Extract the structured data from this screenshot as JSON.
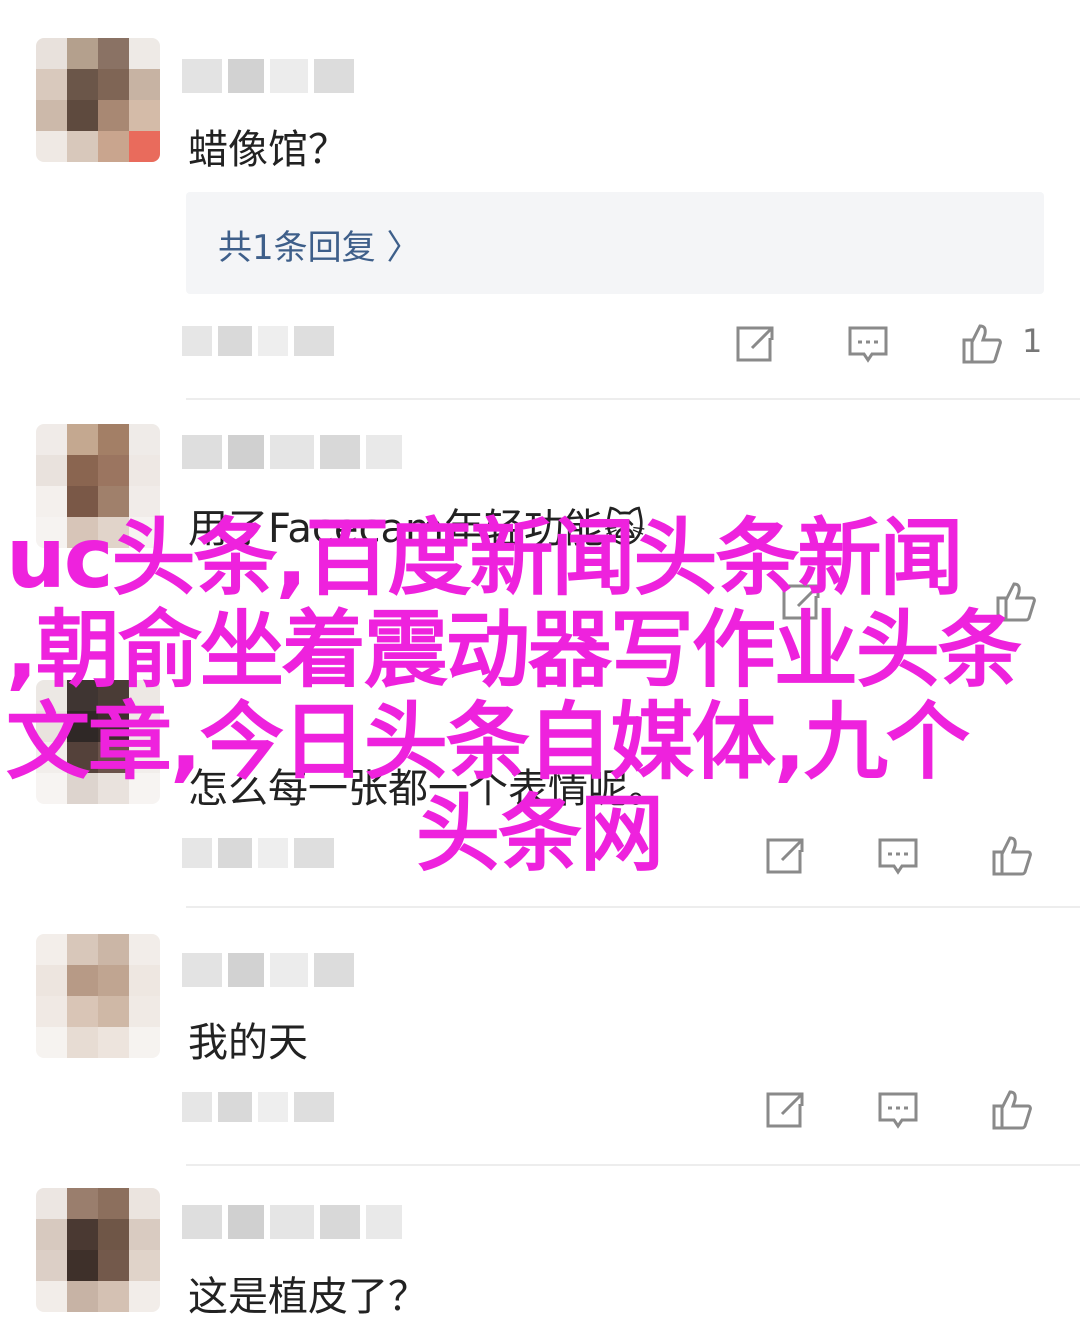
{
  "comments": [
    {
      "text": "蜡像馆？",
      "replies_label": "共1条回复 〉",
      "like_count": "1"
    },
    {
      "text": "用了Facecam年轻功能🙀"
    },
    {
      "text": "怎么每一张都一个表情呢。"
    },
    {
      "text": "我的天"
    },
    {
      "text": "这是植皮了？"
    }
  ],
  "overlay": {
    "line1": "uc头条,百度新闻头条新闻",
    "line2": ",朝俞坐着震动器写作业头条",
    "line3": "文章,今日头条自媒体,九个",
    "line4": "头条网",
    "color": "#ee22dd"
  },
  "icons": {
    "share": "share-icon",
    "reply": "comment-icon",
    "like": "thumbs-up-icon"
  },
  "colors": {
    "reply_link": "#3e5f8a",
    "reply_bg": "#f4f5f7",
    "icon": "#888888"
  }
}
